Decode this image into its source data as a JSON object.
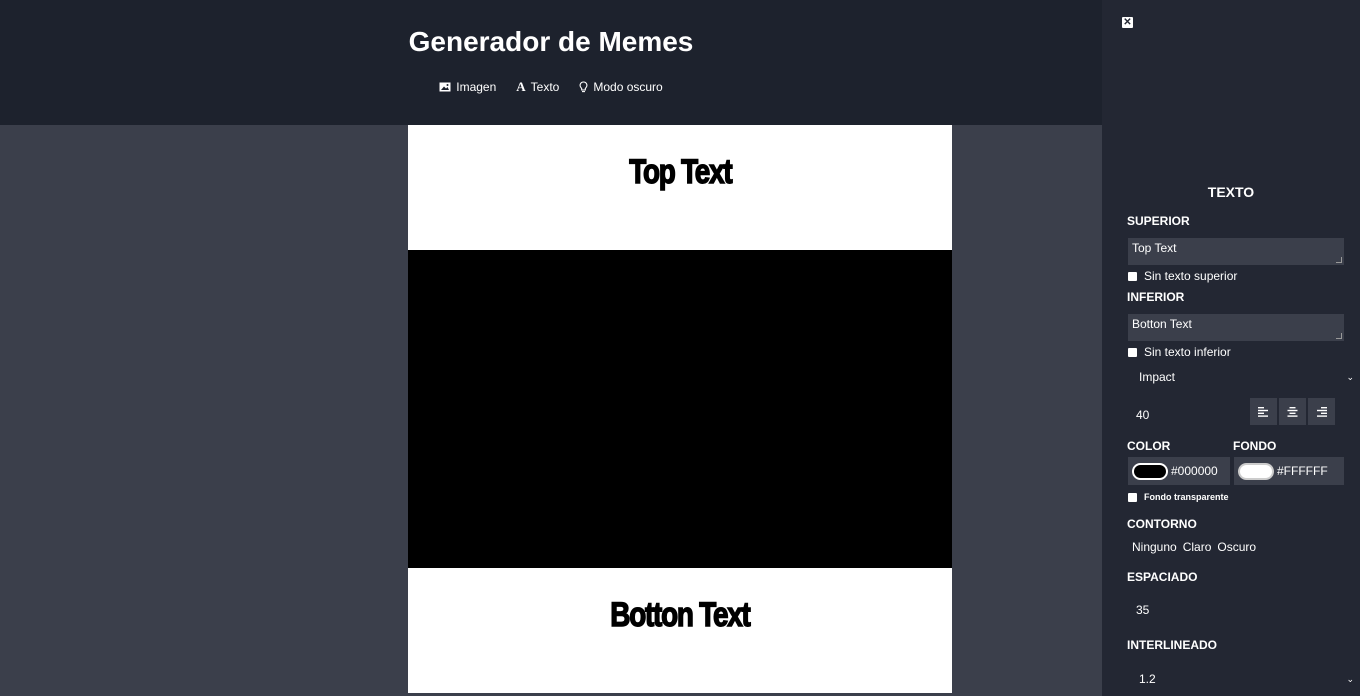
{
  "header": {
    "title": "Generador de Memes",
    "nav": [
      {
        "label": "Imagen",
        "icon": "image-icon"
      },
      {
        "label": "Texto",
        "icon": "font-icon"
      },
      {
        "label": "Modo oscuro",
        "icon": "lightbulb-icon"
      }
    ]
  },
  "meme": {
    "top_text": "Top Text",
    "bottom_text": "Botton Text"
  },
  "panel": {
    "title": "TEXTO",
    "top_label": "SUPERIOR",
    "top_value": "Top Text",
    "no_top_label": "Sin texto superior",
    "bottom_label": "INFERIOR",
    "bottom_value": "Botton Text",
    "no_bottom_label": "Sin texto inferior",
    "font": "Impact",
    "font_size": "40",
    "color_label": "COLOR",
    "bg_label": "FONDO",
    "color_value": "#000000",
    "bg_value": "#FFFFFF",
    "transparent_label": "Fondo transparente",
    "outline_label": "CONTORNO",
    "outline_options": [
      "Ninguno",
      "Claro",
      "Oscuro"
    ],
    "spacing_label": "ESPACIADO",
    "spacing_value": "35",
    "line_height_label": "INTERLINEADO",
    "line_height_value": "1.2"
  },
  "colors": {
    "header_bg": "#1d222d",
    "panel_bg": "#232733",
    "body_bg": "#3b3f4b"
  }
}
